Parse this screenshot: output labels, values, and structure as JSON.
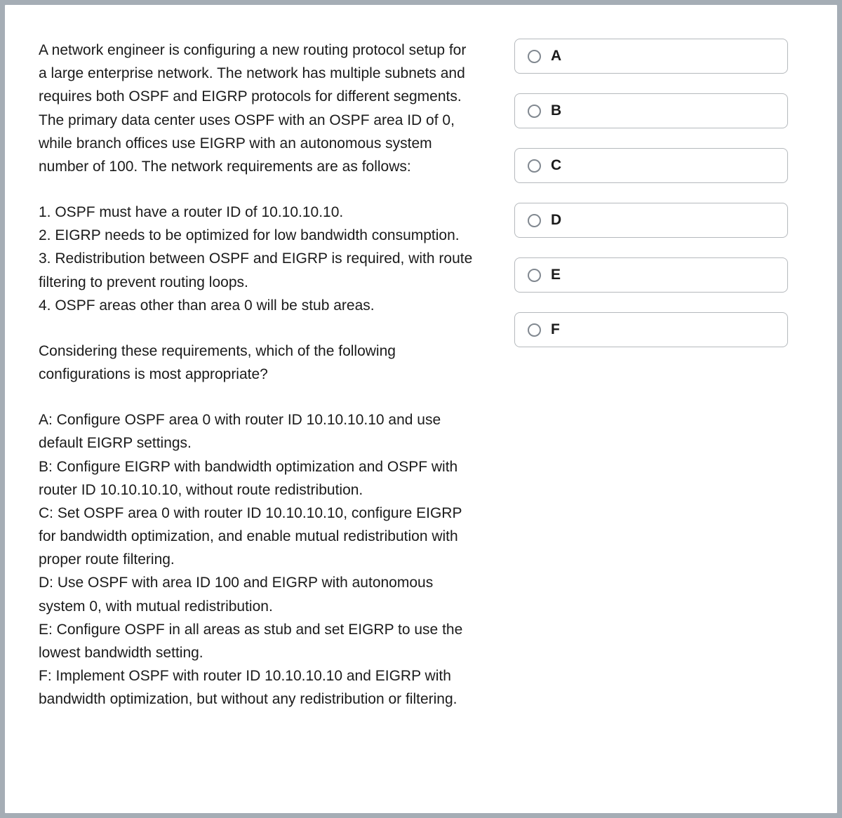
{
  "question": {
    "intro": "A network engineer is configuring a new routing protocol setup for a large enterprise network. The network has multiple subnets and requires both OSPF and EIGRP protocols for different segments. The primary data center uses OSPF with an OSPF area ID of 0, while branch offices use EIGRP with an autonomous system number of 100. The network requirements are as follows:",
    "requirements": "1. OSPF must have a router ID of 10.10.10.10.\n2. EIGRP needs to be optimized for low bandwidth consumption.\n3. Redistribution between OSPF and EIGRP is required, with route filtering to prevent routing loops.\n4. OSPF areas other than area 0 will be stub areas.",
    "prompt": "Considering these requirements, which of the following configurations is most appropriate?",
    "choices_text": "A: Configure OSPF area 0 with router ID 10.10.10.10 and use default EIGRP settings.\nB: Configure EIGRP with bandwidth optimization and OSPF with router ID 10.10.10.10, without route redistribution.\nC: Set OSPF area 0 with router ID 10.10.10.10, configure EIGRP for bandwidth optimization, and enable mutual redistribution with proper route filtering.\nD: Use OSPF with area ID 100 and EIGRP with autonomous system 0, with mutual redistribution.\nE: Configure OSPF in all areas as stub and set EIGRP to use the lowest bandwidth setting.\nF: Implement OSPF with router ID 10.10.10.10 and EIGRP with bandwidth optimization, but without any redistribution or filtering."
  },
  "answers": [
    {
      "label": "A"
    },
    {
      "label": "B"
    },
    {
      "label": "C"
    },
    {
      "label": "D"
    },
    {
      "label": "E"
    },
    {
      "label": "F"
    }
  ]
}
